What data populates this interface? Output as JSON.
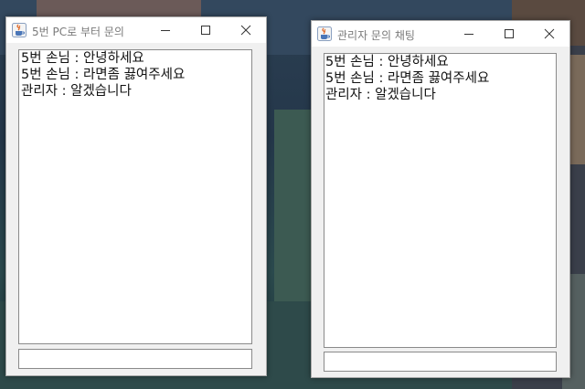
{
  "windows": [
    {
      "title": "5번 PC로 부터 문의",
      "messages": [
        "5번 손님 : 안녕하세요",
        "5번 손님 : 라면좀 끓여주세요",
        "관리자 : 알겠습니다"
      ],
      "input_value": ""
    },
    {
      "title": "관리자 문의 채팅",
      "messages": [
        "5번 손님 : 안녕하세요",
        "5번 손님 : 라면좀 끓여주세요",
        "관리자 : 알겠습니다"
      ],
      "input_value": ""
    }
  ],
  "icons": {
    "app": "java-cup-icon",
    "minimize": "minimize-icon",
    "maximize": "maximize-icon",
    "close": "close-icon"
  },
  "colors": {
    "titlebar_bg": "#ffffff",
    "title_text": "#7a7a7a",
    "window_bg": "#f0f0f0",
    "text_area_bg": "#ffffff",
    "text_color": "#111111",
    "border": "#8a8a8a"
  }
}
